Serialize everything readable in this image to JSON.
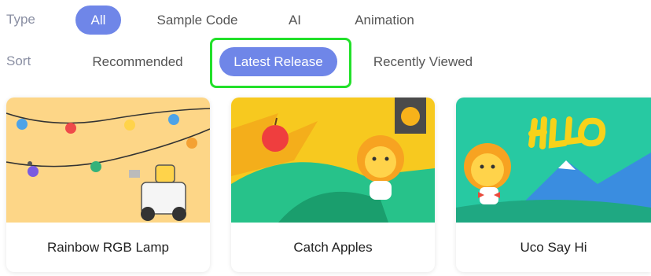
{
  "filters": {
    "type": {
      "label": "Type",
      "options": [
        "All",
        "Sample Code",
        "AI",
        "Animation"
      ],
      "selected": "All"
    },
    "sort": {
      "label": "Sort",
      "options": [
        "Recommended",
        "Latest Release",
        "Recently Viewed"
      ],
      "selected": "Latest Release"
    }
  },
  "highlight_color": "#22e02a",
  "accent_color": "#6f86e8",
  "cards": [
    {
      "title": "Rainbow RGB Lamp",
      "thumb_icon": "robot-lamp-illustration"
    },
    {
      "title": "Catch Apples",
      "thumb_icon": "lion-apple-illustration"
    },
    {
      "title": "Uco Say Hi",
      "thumb_icon": "lion-hello-illustration"
    }
  ]
}
